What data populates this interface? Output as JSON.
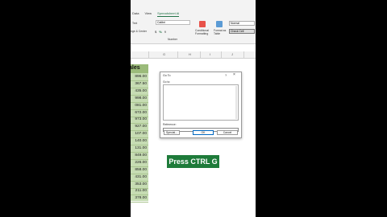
{
  "ribbon": {
    "tabs": [
      "Data",
      "View",
      "Spreadsheet AI"
    ],
    "active_tab": 2,
    "left_labels": [
      "Text",
      "nge & Center"
    ],
    "font_name": "Calibri",
    "number_label": "Number",
    "number_buttons": [
      "$",
      "%",
      "9"
    ],
    "cond_format_label": "Conditional Formatting",
    "format_table_label": "Format as Table",
    "style_normal": "Normal",
    "style_check": "Check Cell"
  },
  "columns": [
    "G",
    "H",
    "I",
    "J"
  ],
  "sales": {
    "header": "ales",
    "values": [
      "896.00",
      "367.50",
      "435.00",
      "998.00",
      "081.00",
      "672.00",
      "973.00",
      "927.00",
      "107.00",
      "140.00",
      "131.00",
      "849.00",
      "226.00",
      "858.00",
      "431.00",
      "353.00",
      "211.00",
      "378.00"
    ]
  },
  "dialog": {
    "title": "Go To",
    "help": "?",
    "close": "×",
    "goto_label": "Go to:",
    "reference_label": "Reference:",
    "special_button": "Special...",
    "ok_button": "OK",
    "cancel_button": "Cancel"
  },
  "caption": "Press CTRL G",
  "colors": {
    "accent": "#217346",
    "caption_bg": "#1e7b3a",
    "sales_fill": "#c6dcb3"
  }
}
